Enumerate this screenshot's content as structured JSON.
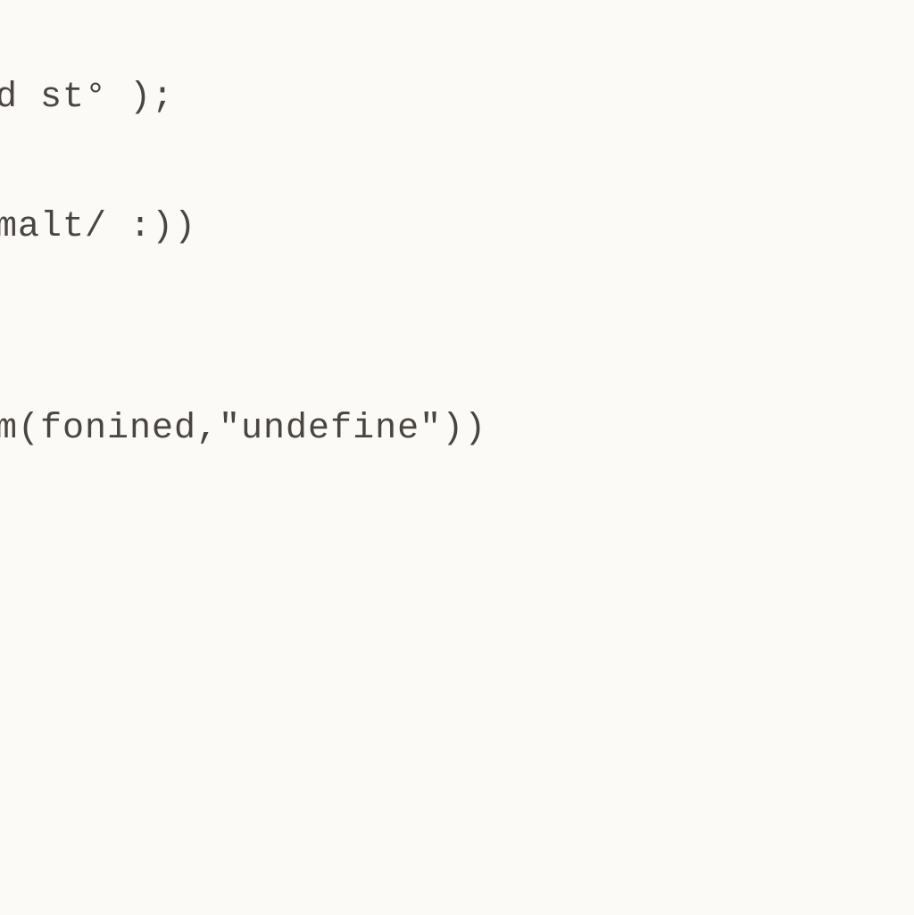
{
  "code": {
    "line1": "ud st° );",
    "line2": "omalt/ :))",
    "line3": "cm(fonined,\"undefine\"))",
    "line4": ")"
  }
}
